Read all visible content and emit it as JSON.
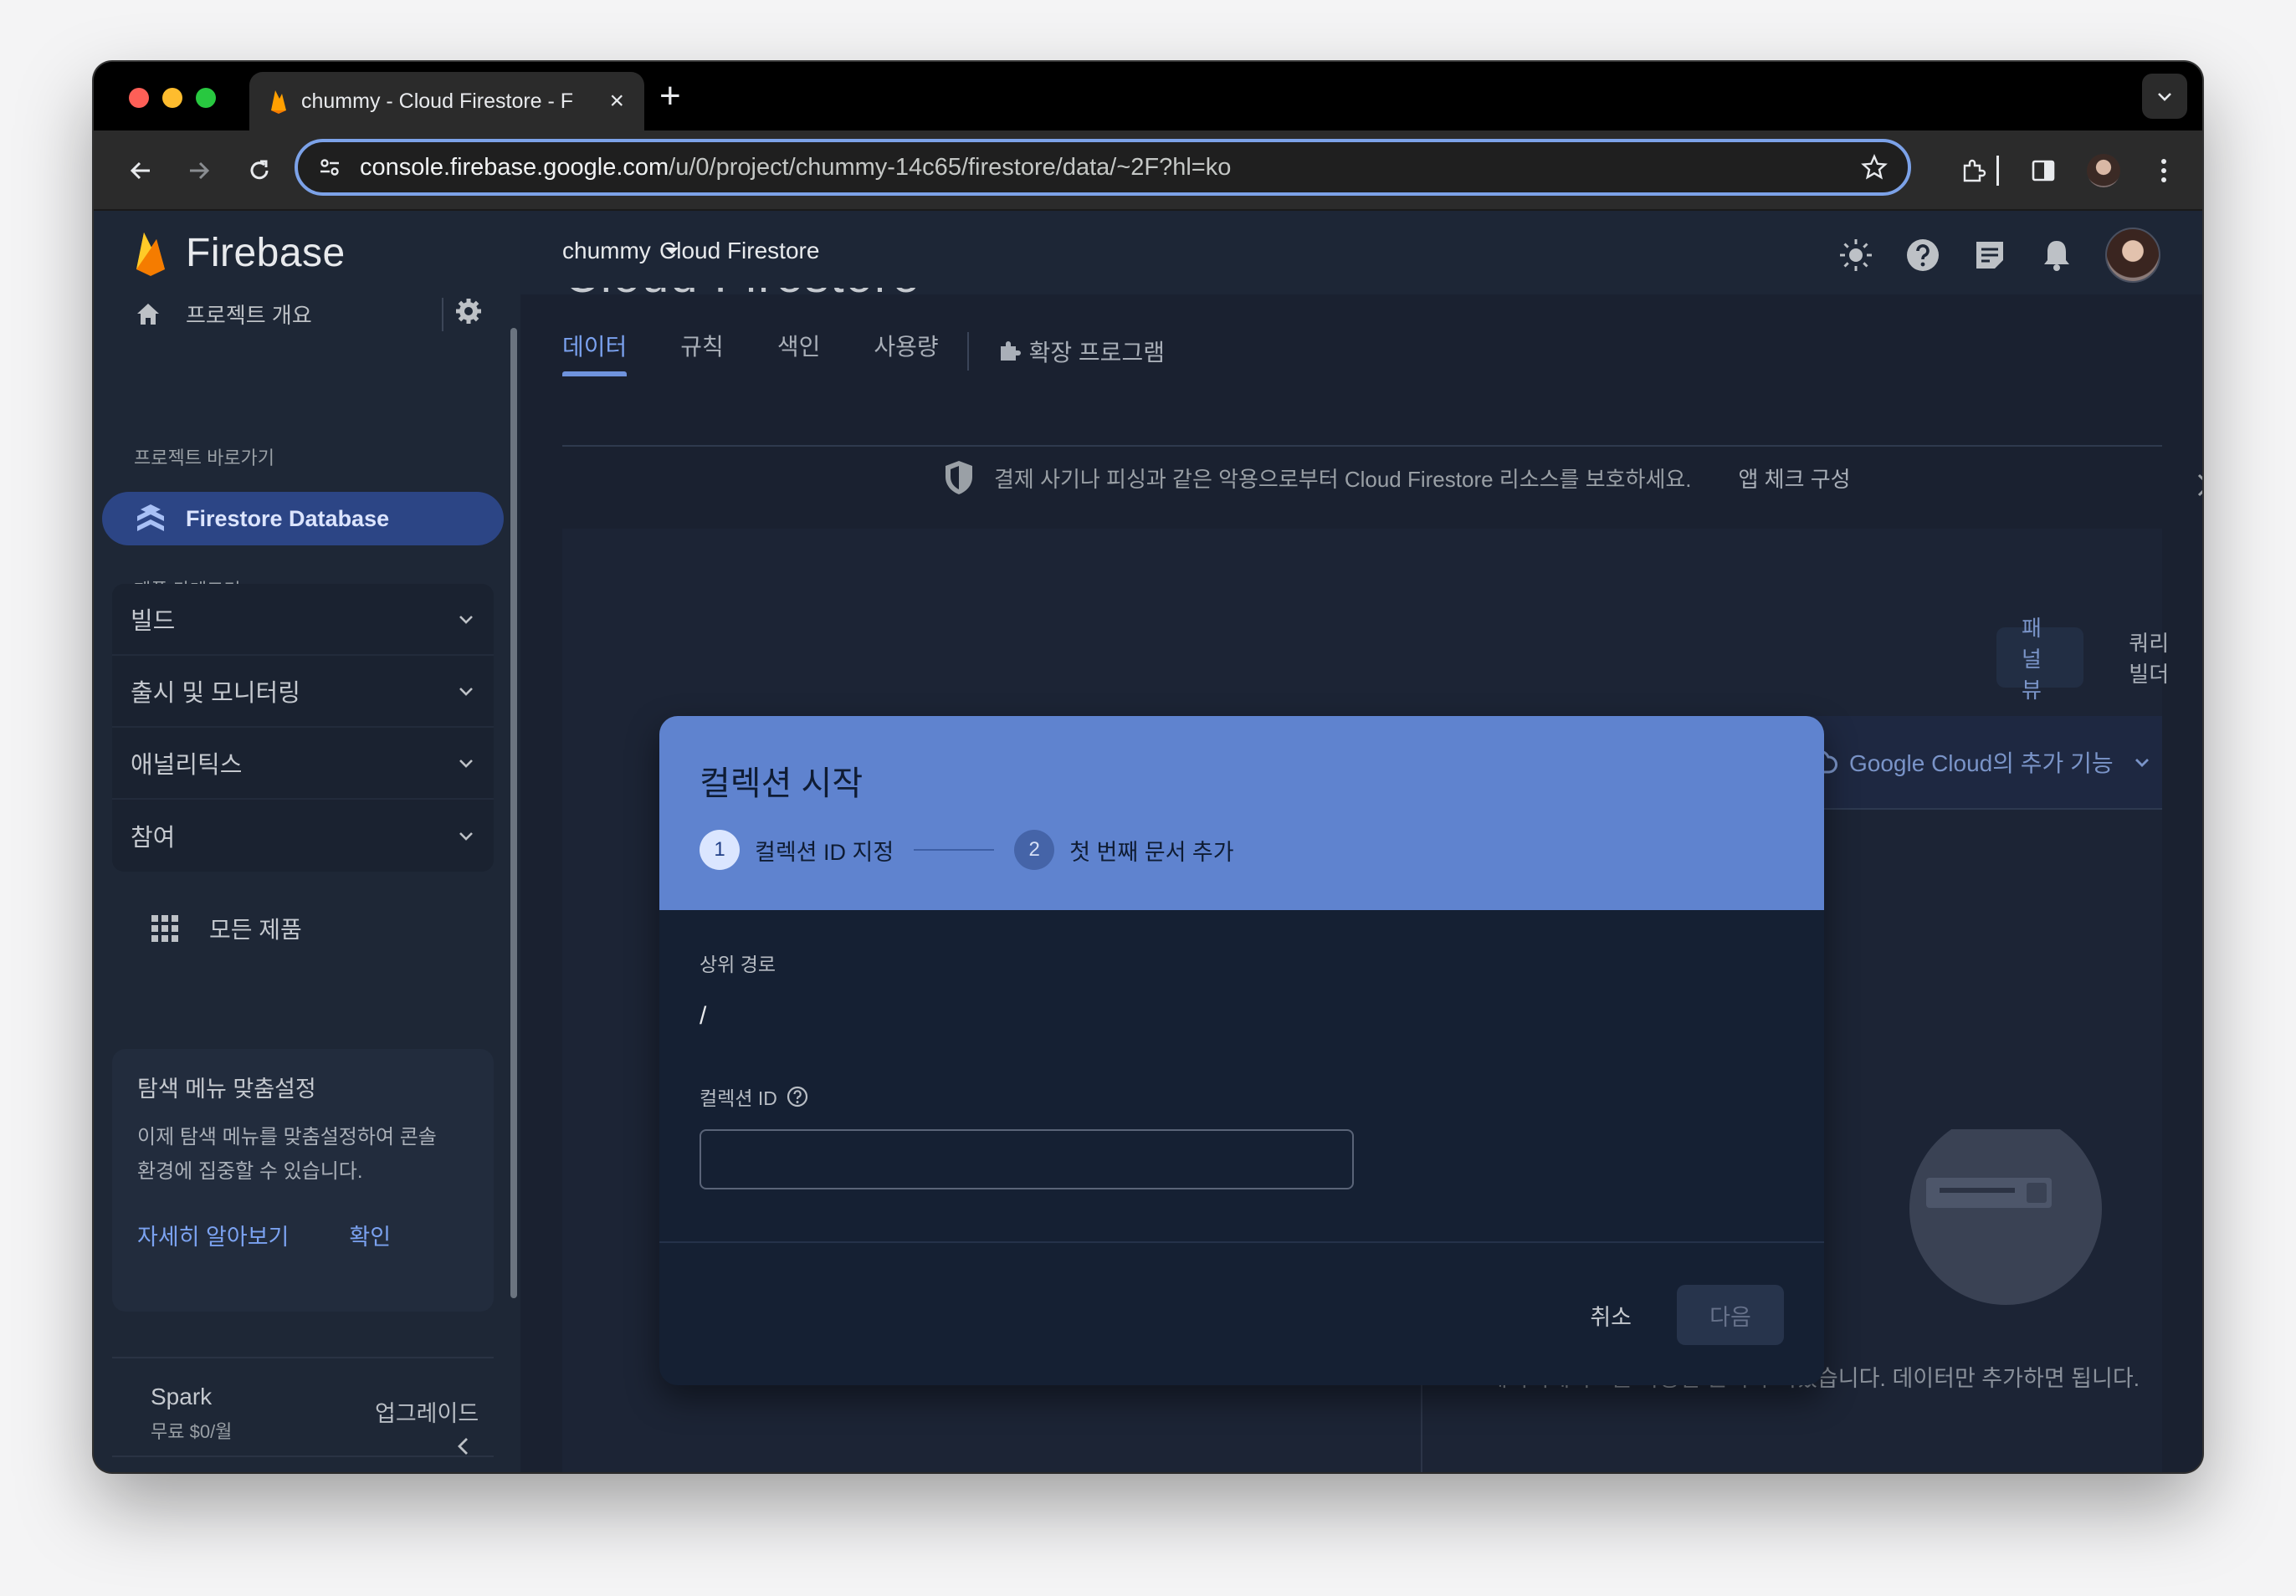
{
  "browser": {
    "tab_title": "chummy - Cloud Firestore - F",
    "url_host": "console.firebase.google.com",
    "url_path": "/u/0/project/chummy-14c65/firestore/data/~2F?hl=ko"
  },
  "sidebar": {
    "logo": "Firebase",
    "overview": "프로젝트 개요",
    "shortcuts_label": "프로젝트 바로가기",
    "active_item": "Firestore Database",
    "categories_label": "제품 카테고리",
    "categories": [
      "빌드",
      "출시 및 모니터링",
      "애널리틱스",
      "참여"
    ],
    "all_products": "모든 제품",
    "promo": {
      "title": "탐색 메뉴 맞춤설정",
      "body_line1": "이제 탐색 메뉴를 맞춤설정하여 콘솔",
      "body_line2": "환경에 집중할 수 있습니다.",
      "learn_more": "자세히 알아보기",
      "confirm": "확인"
    },
    "plan": {
      "name": "Spark",
      "price": "무료 $0/월",
      "upgrade": "업그레이드"
    }
  },
  "header": {
    "project": "chummy",
    "product": "Cloud Firestore",
    "page_title": "Cloud Firestore"
  },
  "tabs": [
    "데이터",
    "규칙",
    "색인",
    "사용량"
  ],
  "extensions_tab": "확장 프로그램",
  "banner": {
    "text": "결제 사기나 피싱과 같은 악용으로부터 Cloud Firestore 리소스를 보호하세요.",
    "action": "앱 체크 구성"
  },
  "view_buttons": {
    "panel": "패널 뷰",
    "query": "쿼리 빌더"
  },
  "gcloud": "Google Cloud의 추가 기능",
  "empty_state": "데이터베이스를 사용할 준비가 되었습니다. 데이터만 추가하면 됩니다.",
  "dialog": {
    "title": "컬렉션 시작",
    "step1_num": "1",
    "step1_label": "컬렉션 ID 지정",
    "step2_num": "2",
    "step2_label": "첫 번째 문서 추가",
    "parent_path_label": "상위 경로",
    "parent_path_value": "/",
    "collection_id_label": "컬렉션 ID",
    "collection_id_value": "",
    "cancel": "취소",
    "next": "다음"
  },
  "colors": {
    "accent": "#7ba2f0",
    "dialog_header": "#5f83cf",
    "active_nav": "#2c4585"
  }
}
